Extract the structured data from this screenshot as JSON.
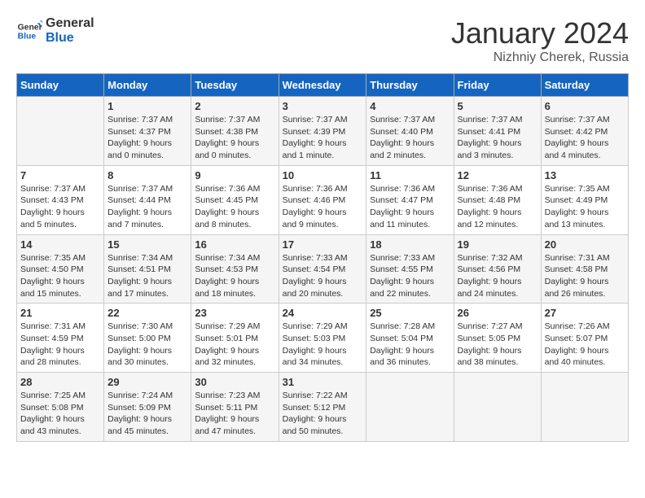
{
  "header": {
    "logo_line1": "General",
    "logo_line2": "Blue",
    "title": "January 2024",
    "subtitle": "Nizhniy Cherek, Russia"
  },
  "weekdays": [
    "Sunday",
    "Monday",
    "Tuesday",
    "Wednesday",
    "Thursday",
    "Friday",
    "Saturday"
  ],
  "weeks": [
    [
      {
        "day": "",
        "info": ""
      },
      {
        "day": "1",
        "info": "Sunrise: 7:37 AM\nSunset: 4:37 PM\nDaylight: 9 hours\nand 0 minutes."
      },
      {
        "day": "2",
        "info": "Sunrise: 7:37 AM\nSunset: 4:38 PM\nDaylight: 9 hours\nand 0 minutes."
      },
      {
        "day": "3",
        "info": "Sunrise: 7:37 AM\nSunset: 4:39 PM\nDaylight: 9 hours\nand 1 minute."
      },
      {
        "day": "4",
        "info": "Sunrise: 7:37 AM\nSunset: 4:40 PM\nDaylight: 9 hours\nand 2 minutes."
      },
      {
        "day": "5",
        "info": "Sunrise: 7:37 AM\nSunset: 4:41 PM\nDaylight: 9 hours\nand 3 minutes."
      },
      {
        "day": "6",
        "info": "Sunrise: 7:37 AM\nSunset: 4:42 PM\nDaylight: 9 hours\nand 4 minutes."
      }
    ],
    [
      {
        "day": "7",
        "info": "Sunrise: 7:37 AM\nSunset: 4:43 PM\nDaylight: 9 hours\nand 5 minutes."
      },
      {
        "day": "8",
        "info": "Sunrise: 7:37 AM\nSunset: 4:44 PM\nDaylight: 9 hours\nand 7 minutes."
      },
      {
        "day": "9",
        "info": "Sunrise: 7:36 AM\nSunset: 4:45 PM\nDaylight: 9 hours\nand 8 minutes."
      },
      {
        "day": "10",
        "info": "Sunrise: 7:36 AM\nSunset: 4:46 PM\nDaylight: 9 hours\nand 9 minutes."
      },
      {
        "day": "11",
        "info": "Sunrise: 7:36 AM\nSunset: 4:47 PM\nDaylight: 9 hours\nand 11 minutes."
      },
      {
        "day": "12",
        "info": "Sunrise: 7:36 AM\nSunset: 4:48 PM\nDaylight: 9 hours\nand 12 minutes."
      },
      {
        "day": "13",
        "info": "Sunrise: 7:35 AM\nSunset: 4:49 PM\nDaylight: 9 hours\nand 13 minutes."
      }
    ],
    [
      {
        "day": "14",
        "info": "Sunrise: 7:35 AM\nSunset: 4:50 PM\nDaylight: 9 hours\nand 15 minutes."
      },
      {
        "day": "15",
        "info": "Sunrise: 7:34 AM\nSunset: 4:51 PM\nDaylight: 9 hours\nand 17 minutes."
      },
      {
        "day": "16",
        "info": "Sunrise: 7:34 AM\nSunset: 4:53 PM\nDaylight: 9 hours\nand 18 minutes."
      },
      {
        "day": "17",
        "info": "Sunrise: 7:33 AM\nSunset: 4:54 PM\nDaylight: 9 hours\nand 20 minutes."
      },
      {
        "day": "18",
        "info": "Sunrise: 7:33 AM\nSunset: 4:55 PM\nDaylight: 9 hours\nand 22 minutes."
      },
      {
        "day": "19",
        "info": "Sunrise: 7:32 AM\nSunset: 4:56 PM\nDaylight: 9 hours\nand 24 minutes."
      },
      {
        "day": "20",
        "info": "Sunrise: 7:31 AM\nSunset: 4:58 PM\nDaylight: 9 hours\nand 26 minutes."
      }
    ],
    [
      {
        "day": "21",
        "info": "Sunrise: 7:31 AM\nSunset: 4:59 PM\nDaylight: 9 hours\nand 28 minutes."
      },
      {
        "day": "22",
        "info": "Sunrise: 7:30 AM\nSunset: 5:00 PM\nDaylight: 9 hours\nand 30 minutes."
      },
      {
        "day": "23",
        "info": "Sunrise: 7:29 AM\nSunset: 5:01 PM\nDaylight: 9 hours\nand 32 minutes."
      },
      {
        "day": "24",
        "info": "Sunrise: 7:29 AM\nSunset: 5:03 PM\nDaylight: 9 hours\nand 34 minutes."
      },
      {
        "day": "25",
        "info": "Sunrise: 7:28 AM\nSunset: 5:04 PM\nDaylight: 9 hours\nand 36 minutes."
      },
      {
        "day": "26",
        "info": "Sunrise: 7:27 AM\nSunset: 5:05 PM\nDaylight: 9 hours\nand 38 minutes."
      },
      {
        "day": "27",
        "info": "Sunrise: 7:26 AM\nSunset: 5:07 PM\nDaylight: 9 hours\nand 40 minutes."
      }
    ],
    [
      {
        "day": "28",
        "info": "Sunrise: 7:25 AM\nSunset: 5:08 PM\nDaylight: 9 hours\nand 43 minutes."
      },
      {
        "day": "29",
        "info": "Sunrise: 7:24 AM\nSunset: 5:09 PM\nDaylight: 9 hours\nand 45 minutes."
      },
      {
        "day": "30",
        "info": "Sunrise: 7:23 AM\nSunset: 5:11 PM\nDaylight: 9 hours\nand 47 minutes."
      },
      {
        "day": "31",
        "info": "Sunrise: 7:22 AM\nSunset: 5:12 PM\nDaylight: 9 hours\nand 50 minutes."
      },
      {
        "day": "",
        "info": ""
      },
      {
        "day": "",
        "info": ""
      },
      {
        "day": "",
        "info": ""
      }
    ]
  ]
}
